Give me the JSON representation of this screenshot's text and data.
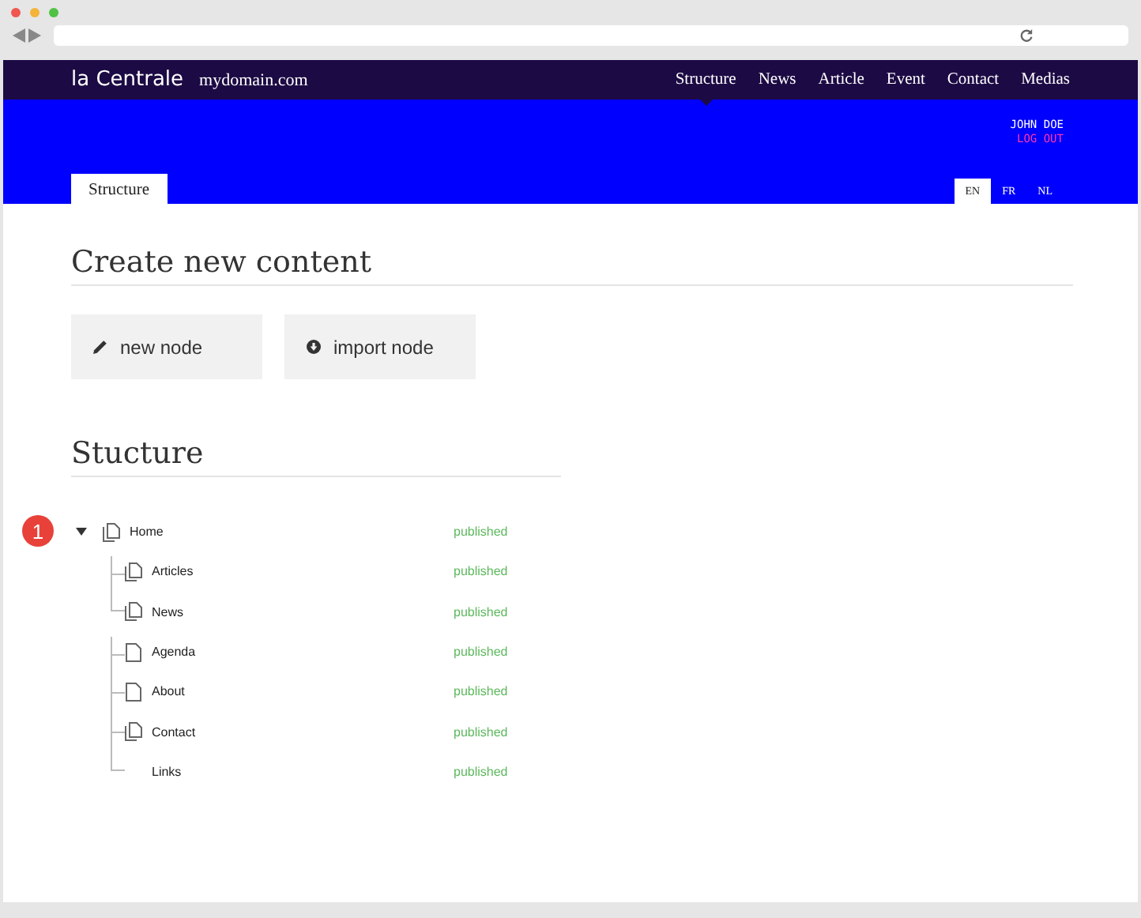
{
  "site": {
    "logo": "la Centrale",
    "domain": "mydomain.com"
  },
  "nav": [
    {
      "label": "Structure",
      "selected": true
    },
    {
      "label": "News",
      "selected": false
    },
    {
      "label": "Article",
      "selected": false
    },
    {
      "label": "Event",
      "selected": false
    },
    {
      "label": "Contact",
      "selected": false
    },
    {
      "label": "Medias",
      "selected": false
    }
  ],
  "user": {
    "name": "JOHN DOE",
    "logout": "LOG OUT"
  },
  "page_tab": "Structure",
  "languages": [
    {
      "label": "EN",
      "selected": true
    },
    {
      "label": "FR",
      "selected": false
    },
    {
      "label": "NL",
      "selected": false
    }
  ],
  "create": {
    "heading": "Create new content",
    "buttons": [
      {
        "kind": "pencil",
        "label": "new node"
      },
      {
        "kind": "download",
        "label": "import node"
      }
    ]
  },
  "structure": {
    "heading": "Stucture",
    "annotation": "1",
    "tree": [
      {
        "label": "Home",
        "kind": "pages",
        "status": "published",
        "expanded": true,
        "children": [
          {
            "label": "Articles",
            "kind": "pages",
            "status": "published",
            "group_start": true
          },
          {
            "label": "News",
            "kind": "pages",
            "status": "published",
            "group_start": false
          },
          {
            "label": "Agenda",
            "kind": "page",
            "status": "published",
            "group_start": true
          },
          {
            "label": "About",
            "kind": "page",
            "status": "published",
            "group_start": false
          },
          {
            "label": "Contact",
            "kind": "pages",
            "status": "published",
            "group_start": false
          },
          {
            "label": "Links",
            "kind": "none",
            "status": "published",
            "group_start": false
          }
        ]
      }
    ]
  }
}
